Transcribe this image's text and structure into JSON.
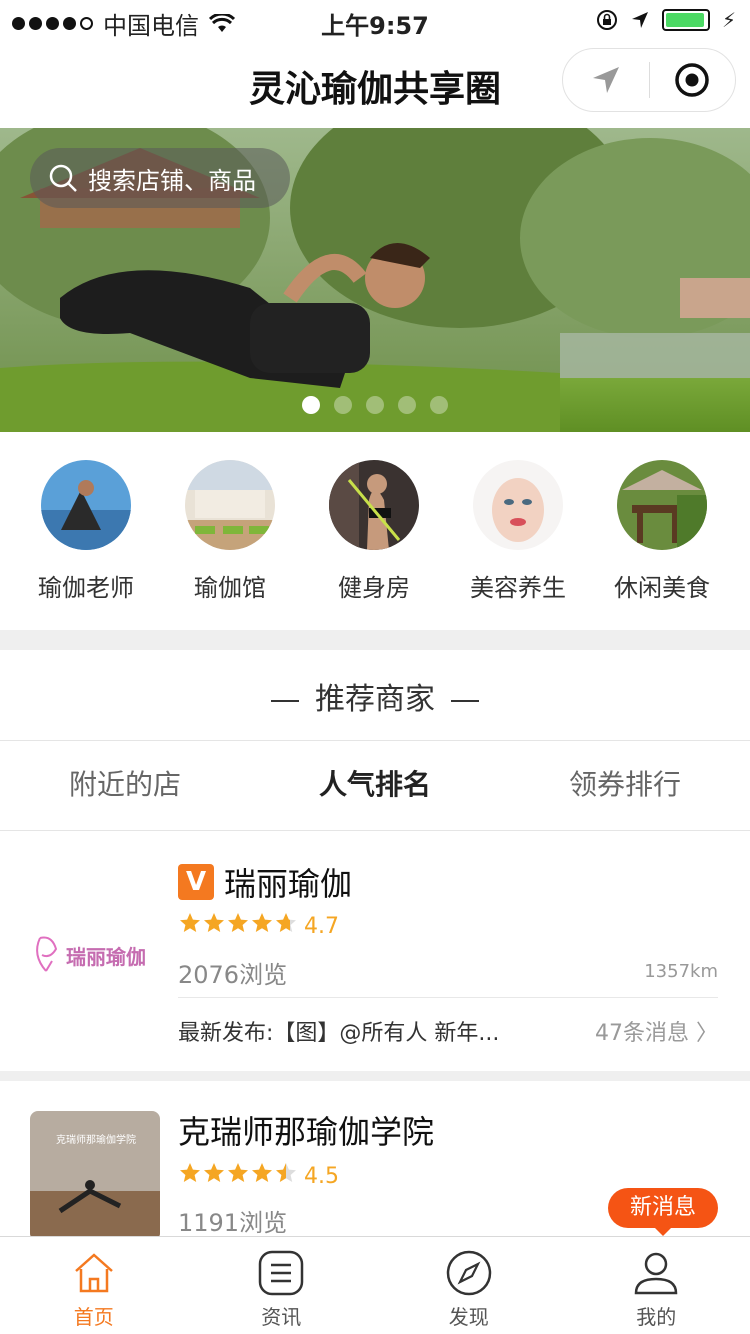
{
  "status_bar": {
    "carrier": "中国电信",
    "time": "上午9:57",
    "battery_level": 0.95
  },
  "nav": {
    "title": "灵沁瑜伽共享圈"
  },
  "banner": {
    "search_placeholder": "搜索店铺、商品",
    "slide_count": 5,
    "active_slide": 1
  },
  "categories": [
    {
      "label": "瑜伽老师",
      "icon": "yoga-teacher-photo"
    },
    {
      "label": "瑜伽馆",
      "icon": "yoga-studio-photo"
    },
    {
      "label": "健身房",
      "icon": "gym-photo"
    },
    {
      "label": "美容养生",
      "icon": "beauty-photo"
    },
    {
      "label": "休闲美食",
      "icon": "dining-photo"
    }
  ],
  "section": {
    "title": "推荐商家"
  },
  "tabs": [
    {
      "label": "附近的店",
      "active": false
    },
    {
      "label": "人气排名",
      "active": true
    },
    {
      "label": "领券排行",
      "active": false
    }
  ],
  "shops": [
    {
      "name": "瑞丽瑜伽",
      "verified_badge": "V",
      "logo_text": "瑞丽瑜伽",
      "rating": "4.7",
      "views": "2076浏览",
      "distance": "1357km",
      "latest": "最新发布:【图】@所有人 新年...",
      "messages": "47条消息"
    },
    {
      "name": "克瑞师那瑜伽学院",
      "logo_text": "克瑞师那瑜伽学院",
      "rating": "4.5",
      "views": "1191浏览"
    }
  ],
  "popup": {
    "new_message": "新消息"
  },
  "tabbar": [
    {
      "label": "首页",
      "icon": "home-icon",
      "active": true
    },
    {
      "label": "资讯",
      "icon": "news-icon",
      "active": false
    },
    {
      "label": "发现",
      "icon": "compass-icon",
      "active": false
    },
    {
      "label": "我的",
      "icon": "user-icon",
      "active": false
    }
  ],
  "colors": {
    "accent": "#f47920",
    "star": "#f5a623",
    "badge": "#f55414"
  }
}
